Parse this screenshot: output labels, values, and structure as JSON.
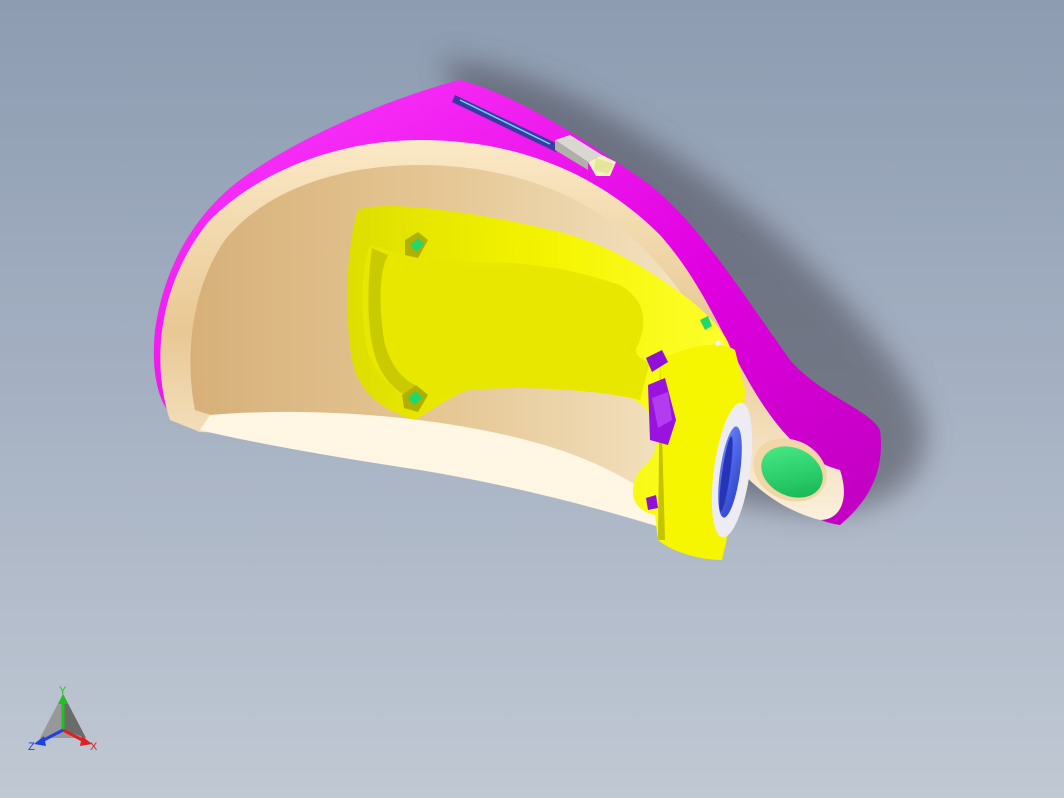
{
  "viewport": {
    "background_top": "#8d9cb1",
    "background_bottom": "#c0c8d3"
  },
  "model": {
    "colors": {
      "outer_shell": "#e800e8",
      "inner_shell": "#f1d7a6",
      "inner_shadow": "#c9a56e",
      "insert": "#f0f000",
      "insert_shadow": "#b8b800",
      "lens": "#3a5ff0",
      "lens_rim": "#e8e8f0",
      "button": "#22d86a",
      "accent_purple": "#9010d8"
    }
  },
  "triad": {
    "y_label": "Y",
    "x_label": "X",
    "z_label": "Z",
    "y_color": "#22c022",
    "x_color": "#e02020",
    "z_color": "#2040e0"
  }
}
